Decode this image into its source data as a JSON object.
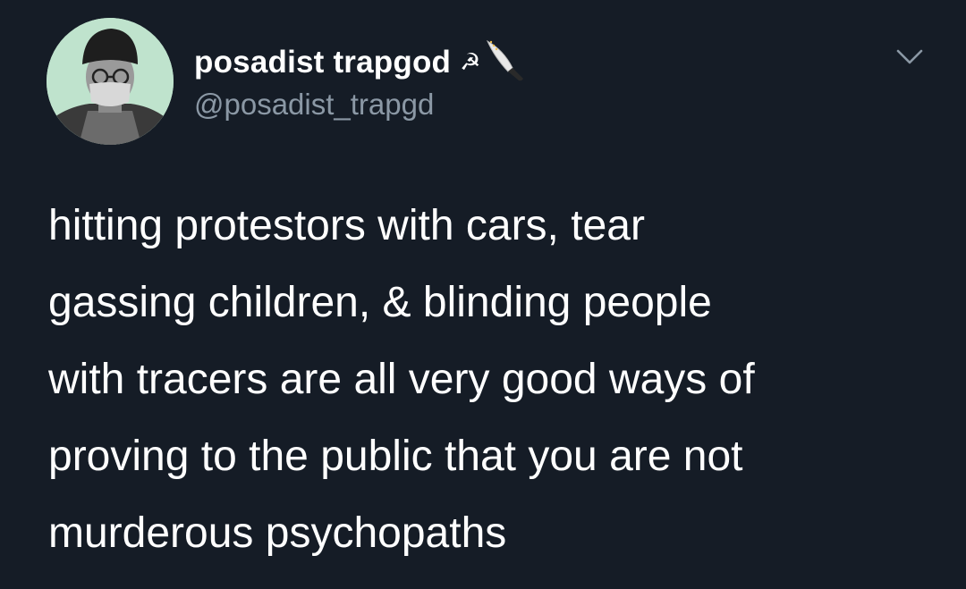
{
  "author": {
    "display_name": "posadist trapgod",
    "name_emoji": "☭",
    "handle": "@posadist_trapgd"
  },
  "icons": {
    "hammer_sickle": "hammer-sickle-icon",
    "knife": "knife-icon",
    "menu": "chevron-down-icon"
  },
  "tweet": {
    "lines": [
      "hitting protestors with cars, tear",
      "gassing children, & blinding people",
      "with tracers are all very good ways of",
      "proving to the public that you are not",
      "murderous psychopaths"
    ]
  },
  "colors": {
    "background": "#151c26",
    "text": "#ffffff",
    "secondary_text": "#8b98a5",
    "avatar_bg": "#bfe3cd"
  }
}
